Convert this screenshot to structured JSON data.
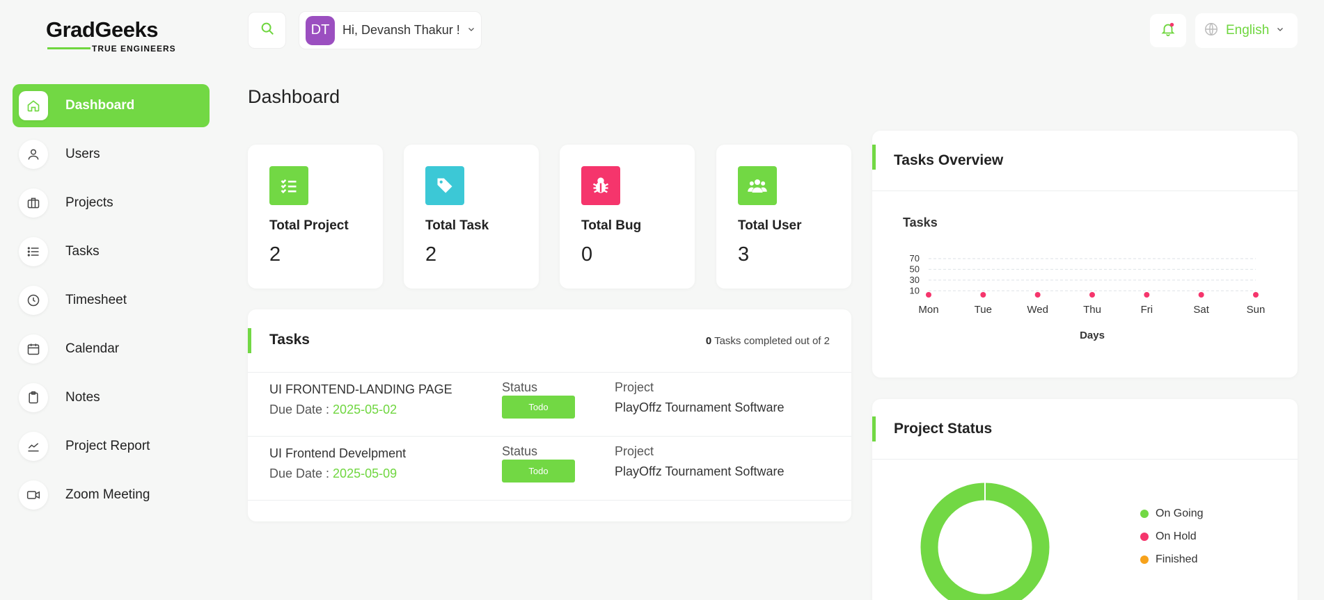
{
  "brand": {
    "name_part1": "Grad",
    "name_part2": "Geeks",
    "tagline": "TRUE ENGINEERS",
    "accent": "#6fd63f"
  },
  "sidebar": {
    "items": [
      {
        "label": "Dashboard",
        "icon": "home-icon",
        "active": true
      },
      {
        "label": "Users",
        "icon": "user-icon"
      },
      {
        "label": "Projects",
        "icon": "briefcase-icon"
      },
      {
        "label": "Tasks",
        "icon": "list-icon"
      },
      {
        "label": "Timesheet",
        "icon": "clock-icon"
      },
      {
        "label": "Calendar",
        "icon": "calendar-icon"
      },
      {
        "label": "Notes",
        "icon": "clipboard-icon"
      },
      {
        "label": "Project Report",
        "icon": "chart-line-icon"
      },
      {
        "label": "Zoom Meeting",
        "icon": "video-icon"
      }
    ]
  },
  "header": {
    "avatar_initials": "DT",
    "greeting": "Hi, Devansh Thakur !",
    "language": "English"
  },
  "page": {
    "title": "Dashboard"
  },
  "stats": [
    {
      "label": "Total Project",
      "value": "2",
      "icon": "checklist-icon",
      "color": "#72d844"
    },
    {
      "label": "Total Task",
      "value": "2",
      "icon": "tag-icon",
      "color": "#3cc8d6"
    },
    {
      "label": "Total Bug",
      "value": "0",
      "icon": "bug-icon",
      "color": "#f5356c"
    },
    {
      "label": "Total User",
      "value": "3",
      "icon": "users-icon",
      "color": "#72d844"
    }
  ],
  "tasks": {
    "title": "Tasks",
    "completed_count": "0",
    "completed_text": "Tasks completed out of 2",
    "status_header": "Status",
    "project_header": "Project",
    "due_prefix": "Due Date : ",
    "rows": [
      {
        "name": "UI FRONTEND-LANDING PAGE",
        "due": "2025-05-02",
        "status": "Todo",
        "project": "PlayOffz Tournament Software"
      },
      {
        "name": "UI Frontend Develpment",
        "due": "2025-05-09",
        "status": "Todo",
        "project": "PlayOffz Tournament Software"
      }
    ]
  },
  "overview": {
    "title": "Tasks Overview",
    "chart_data": {
      "type": "scatter",
      "title": "Tasks",
      "xlabel": "Days",
      "ylabel": "",
      "categories": [
        "Mon",
        "Tue",
        "Wed",
        "Thu",
        "Fri",
        "Sat",
        "Sun"
      ],
      "values": [
        0,
        0,
        0,
        0,
        0,
        0,
        0
      ],
      "yticks": [
        10,
        30,
        50,
        70
      ],
      "ylim": [
        0,
        70
      ],
      "grid": true,
      "color": "#f5356c"
    }
  },
  "project_status": {
    "title": "Project Status",
    "chart_data": {
      "type": "pie",
      "labels": [
        "On Going",
        "On Hold",
        "Finished"
      ],
      "values": [
        1,
        0,
        0
      ],
      "colors": [
        "#72d844",
        "#f5356c",
        "#f7a21b"
      ]
    }
  }
}
